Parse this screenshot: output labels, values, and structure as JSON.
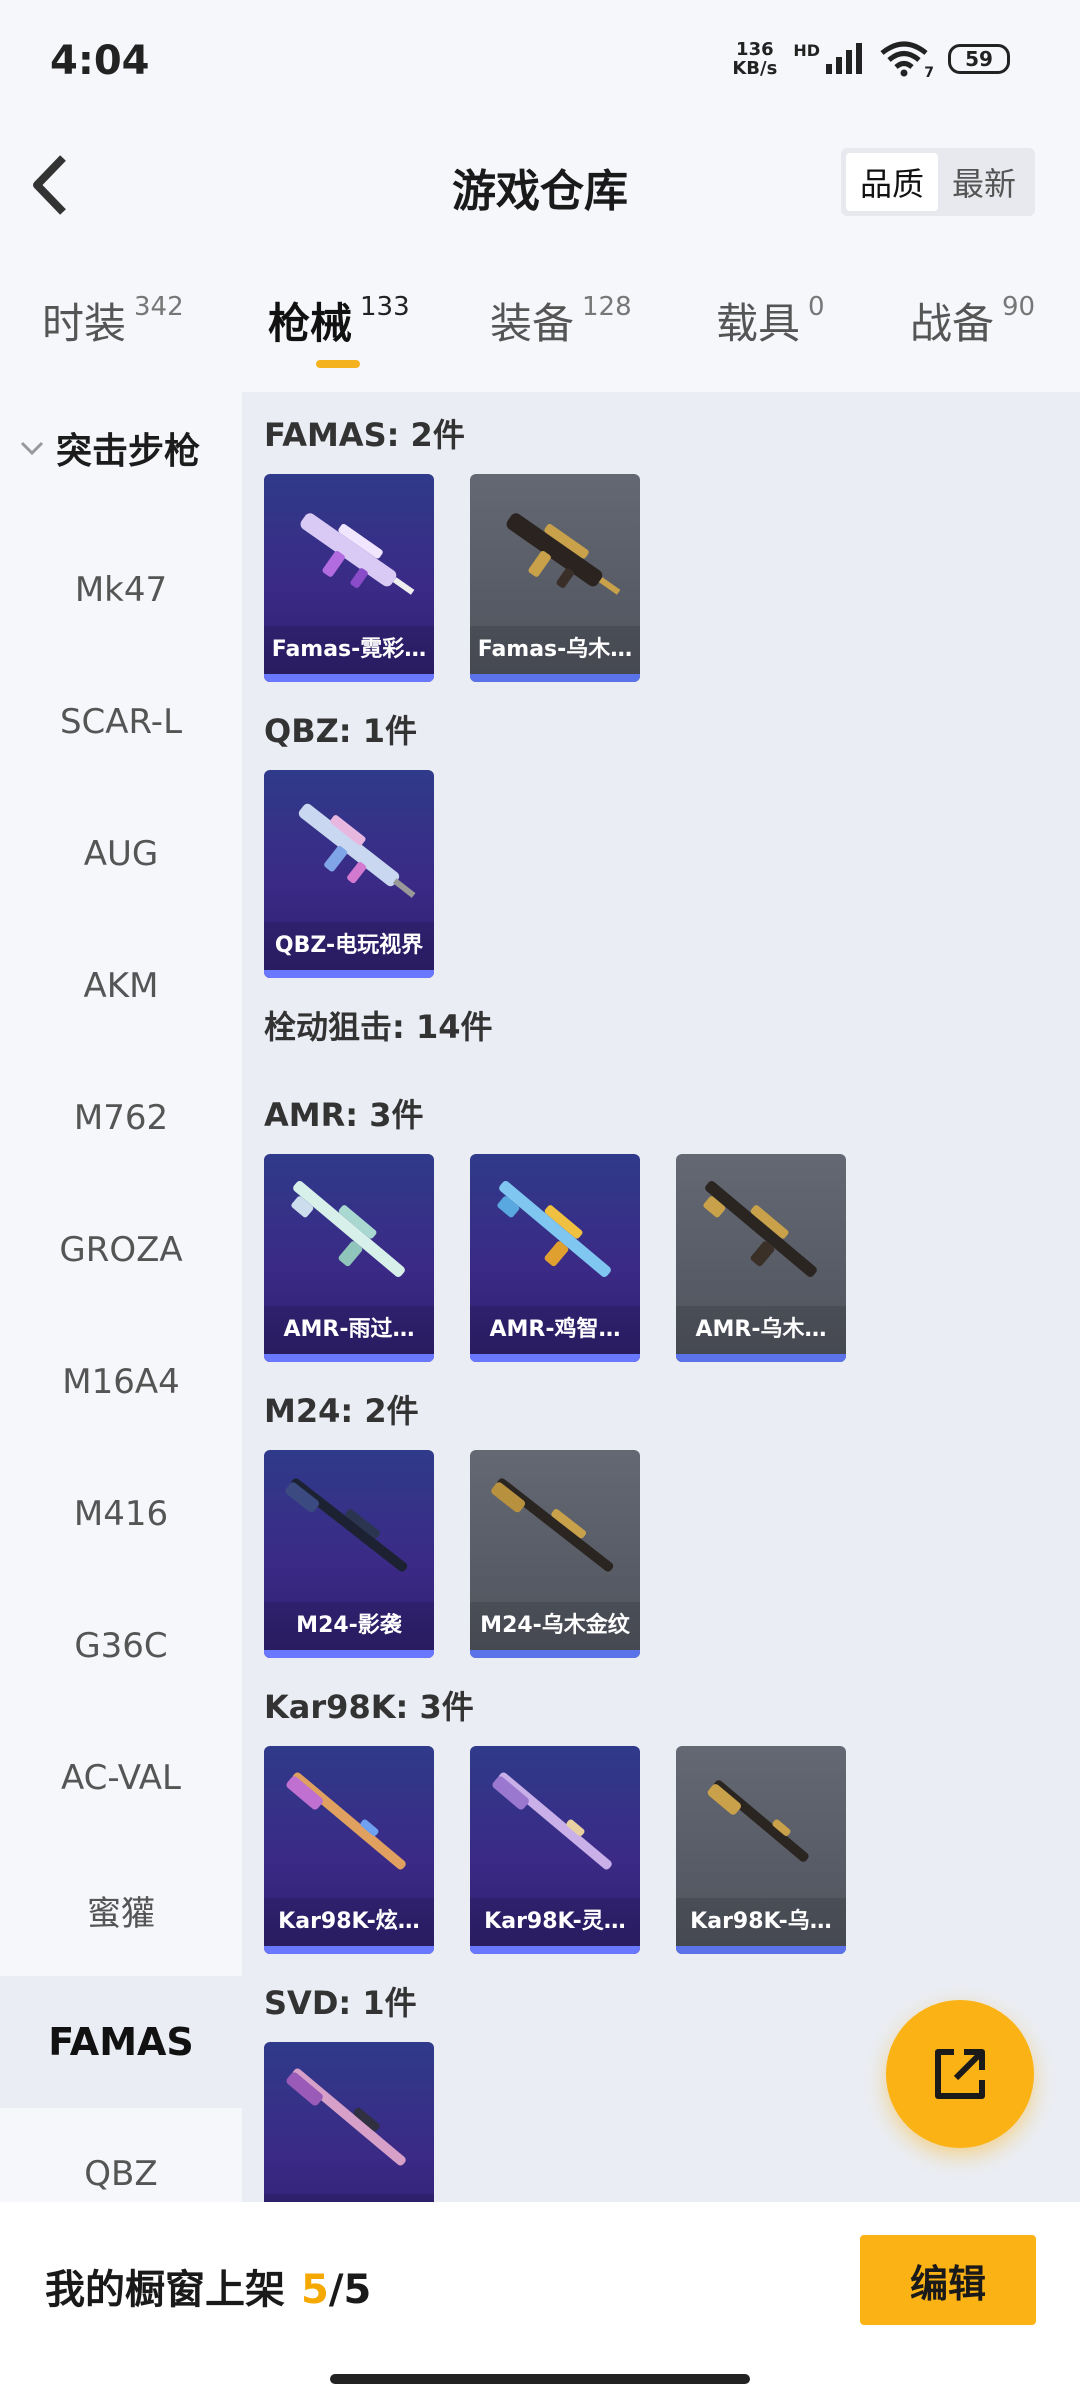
{
  "status": {
    "time": "4:04",
    "net_speed_value": "136",
    "net_speed_unit": "KB/s",
    "hd": "HD",
    "wifi_sub": "7",
    "battery": "59"
  },
  "header": {
    "title": "游戏仓库",
    "sort_options": [
      "品质",
      "最新"
    ],
    "sort_selected": "品质"
  },
  "tabs": [
    {
      "label": "时装",
      "count": "342"
    },
    {
      "label": "枪械",
      "count": "133",
      "active": true
    },
    {
      "label": "装备",
      "count": "128"
    },
    {
      "label": "载具",
      "count": "0"
    },
    {
      "label": "战备",
      "count": "90"
    }
  ],
  "sidebar": {
    "group_label": "突击步枪",
    "items": [
      "Mk47",
      "SCAR-L",
      "AUG",
      "AKM",
      "M762",
      "GROZA",
      "M16A4",
      "M416",
      "G36C",
      "AC-VAL",
      "蜜獾",
      "FAMAS",
      "QBZ"
    ],
    "active_item": "FAMAS"
  },
  "sections": {
    "famas": {
      "title": "FAMAS: 2件",
      "items": [
        {
          "label": "Famas-霓彩…",
          "rarity": "purple"
        },
        {
          "label": "Famas-乌木…",
          "rarity": "gray"
        }
      ]
    },
    "qbz": {
      "title": "QBZ: 1件",
      "items": [
        {
          "label": "QBZ-电玩视界",
          "rarity": "purple"
        }
      ]
    },
    "bolt": {
      "title": "栓动狙击: 14件"
    },
    "amr": {
      "title": "AMR: 3件",
      "items": [
        {
          "label": "AMR-雨过…",
          "rarity": "purple"
        },
        {
          "label": "AMR-鸡智…",
          "rarity": "purple"
        },
        {
          "label": "AMR-乌木…",
          "rarity": "gray"
        }
      ]
    },
    "m24": {
      "title": "M24: 2件",
      "items": [
        {
          "label": "M24-影袭",
          "rarity": "purple"
        },
        {
          "label": "M24-乌木金纹",
          "rarity": "gray"
        }
      ]
    },
    "kar98k": {
      "title": "Kar98K: 3件",
      "items": [
        {
          "label": "Kar98K-炫…",
          "rarity": "purple"
        },
        {
          "label": "Kar98K-灵…",
          "rarity": "purple"
        },
        {
          "label": "Kar98K-乌…",
          "rarity": "gray"
        }
      ]
    },
    "svd": {
      "title": "SVD: 1件",
      "items": [
        {
          "label": "",
          "rarity": "purple"
        }
      ]
    }
  },
  "bottom": {
    "showcase_label": "我的橱窗上架",
    "showcase_count": "5",
    "showcase_sep": "/",
    "showcase_total": "5",
    "edit_label": "编辑"
  },
  "colors": {
    "accent": "#fbb215",
    "count_highlight": "#f5a800",
    "rarity_purple": "#3b2a86",
    "rarity_gray": "#5a5e67",
    "rarity_bar": "#6a78ff"
  },
  "icons": {
    "back": "back-arrow-icon",
    "group_toggle": "chevron-down-icon",
    "fab": "share-external-icon"
  }
}
